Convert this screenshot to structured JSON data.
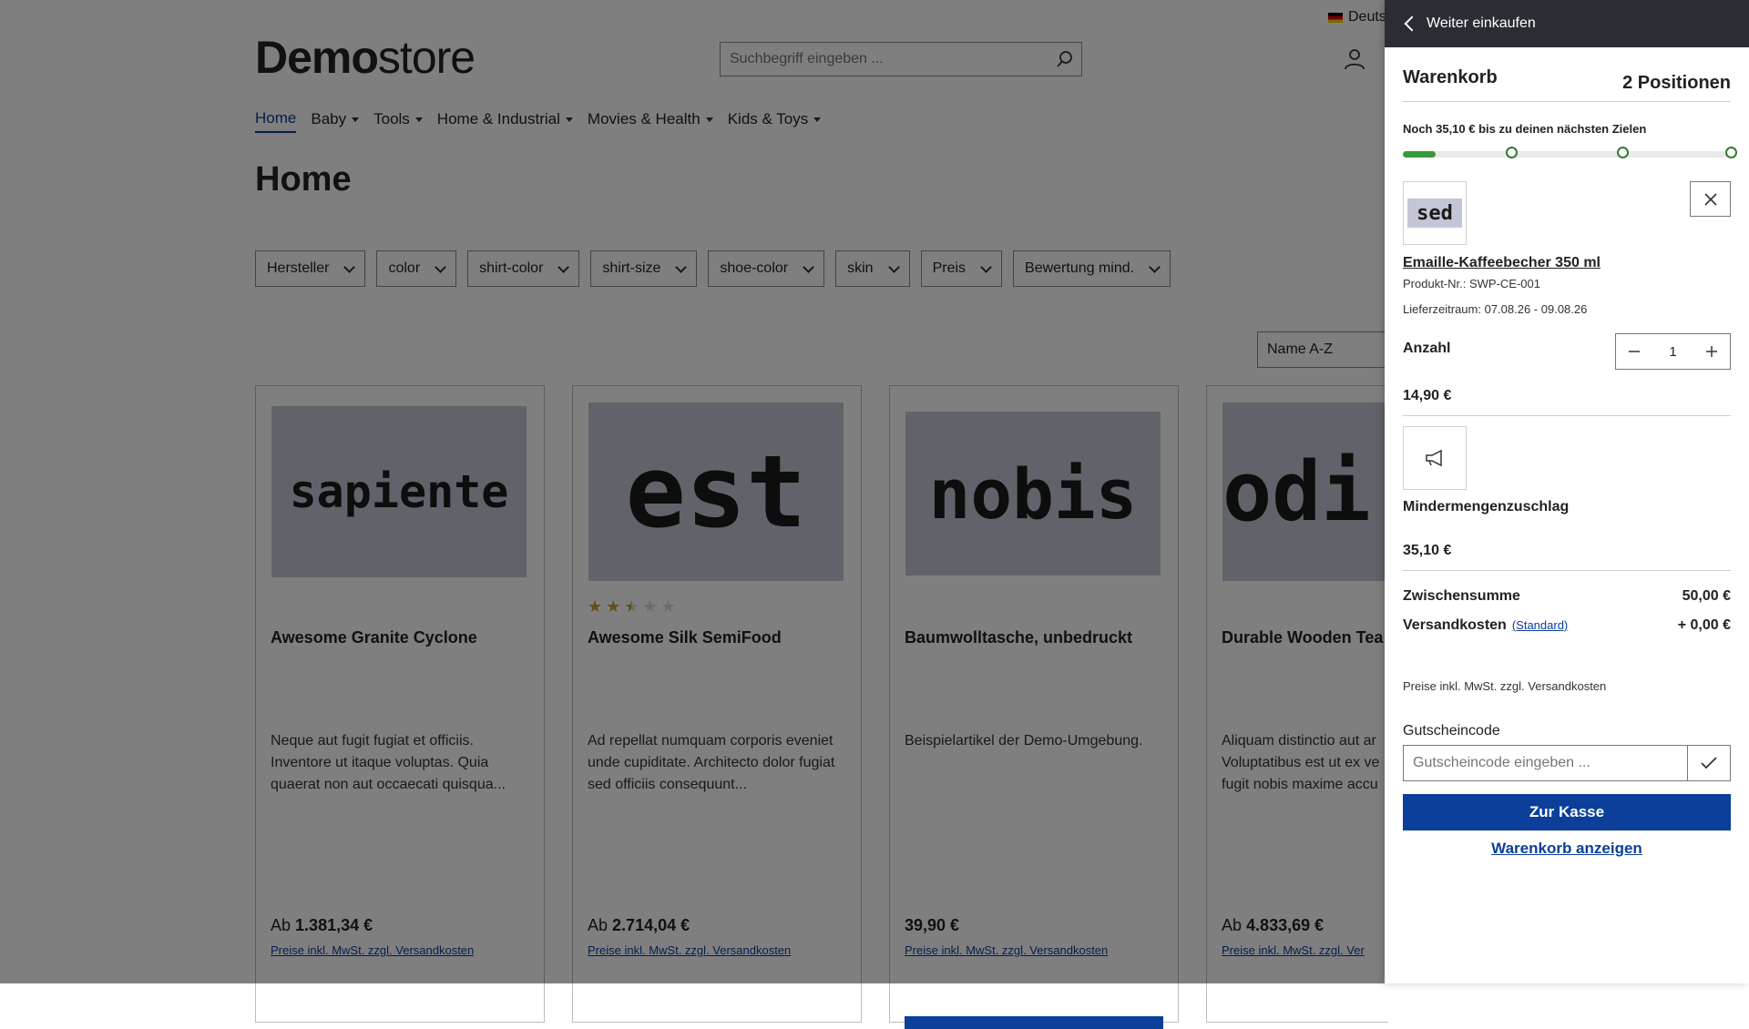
{
  "header": {
    "language": "Deuts",
    "logo_bold": "Demo",
    "logo_light": "store",
    "search_placeholder": "Suchbegriff eingeben ...",
    "search_icon": "search-icon",
    "account_icon": "user-icon"
  },
  "nav": [
    {
      "label": "Home",
      "active": true
    },
    {
      "label": "Baby",
      "dropdown": true
    },
    {
      "label": "Tools",
      "dropdown": true
    },
    {
      "label": "Home & Industrial",
      "dropdown": true
    },
    {
      "label": "Movies & Health",
      "dropdown": true
    },
    {
      "label": "Kids & Toys",
      "dropdown": true
    }
  ],
  "page_title": "Home",
  "filters": [
    "Hersteller",
    "color",
    "shirt-color",
    "shirt-size",
    "shoe-color",
    "skin",
    "Preis",
    "Bewertung mind."
  ],
  "sort": "Name A-Z",
  "products": [
    {
      "image_text": "sapiente",
      "name": "Awesome Granite Cyclone",
      "description": "Neque aut fugit fugiat et officiis. Inventore ut itaque voluptas. Quia quaerat non aut occaecati quisqua...",
      "price_prefix": "Ab",
      "price": "1.381,34 €",
      "vat": "Preise inkl. MwSt. zzgl. Versandkosten"
    },
    {
      "image_text": "est",
      "rating": 2.5,
      "rating_max": 5,
      "name": "Awesome Silk SemiFood",
      "description": "Ad repellat numquam corporis eveniet unde cupiditate. Architecto dolor fugiat sed officiis consequunt...",
      "price_prefix": "Ab",
      "price": "2.714,04 €",
      "vat": "Preise inkl. MwSt. zzgl. Versandkosten"
    },
    {
      "image_text": "nobis",
      "name": "Baumwolltasche, unbedruckt",
      "description": "Beispielartikel der Demo-Umgebung.",
      "price_prefix": "",
      "price": "39,90 €",
      "vat": "Preise inkl. MwSt. zzgl. Versandkosten"
    },
    {
      "image_text": "odi",
      "name": "Durable Wooden Tea",
      "description": "Aliquam distinctio aut ar Voluptatibus est ut ex ve fugit nobis maxime accu",
      "price_prefix": "Ab",
      "price": "4.833,69 €",
      "vat": "Preise inkl. MwSt. zzgl. Ver"
    }
  ],
  "cart": {
    "back_label": "Weiter einkaufen",
    "title": "Warenkorb",
    "count": "2 Positionen",
    "goal_text": "Noch 35,10 € bis zu deinen nächsten Zielen",
    "goal_progress": 0.1,
    "goal_milestones": 3,
    "item1": {
      "thumb_text": "sed",
      "name": "Emaille-Kaffeebecher 350 ml",
      "product_no": "Produkt-Nr.: SWP-CE-001",
      "delivery": "Lieferzeitraum: 07.08.26 - 09.08.26",
      "qty_label": "Anzahl",
      "qty": "1",
      "price": "14,90 €"
    },
    "item2": {
      "icon": "megaphone-icon",
      "name": "Mindermengenzuschlag",
      "price": "35,10 €"
    },
    "subtotal_label": "Zwischensumme",
    "subtotal": "50,00 €",
    "shipping_label": "Versandkosten",
    "shipping_method": "(Standard)",
    "shipping": "+ 0,00 €",
    "note": "Preise inkl. MwSt. zzgl. Versandkosten",
    "voucher_label": "Gutscheincode",
    "voucher_placeholder": "Gutscheincode eingeben ...",
    "checkout": "Zur Kasse",
    "show_cart": "Warenkorb anzeigen"
  },
  "colors": {
    "primary": "#0b3f99",
    "header_dark": "#2b2d33",
    "progress": "#3a9a3a",
    "image_bg": "#c3c6d6"
  }
}
